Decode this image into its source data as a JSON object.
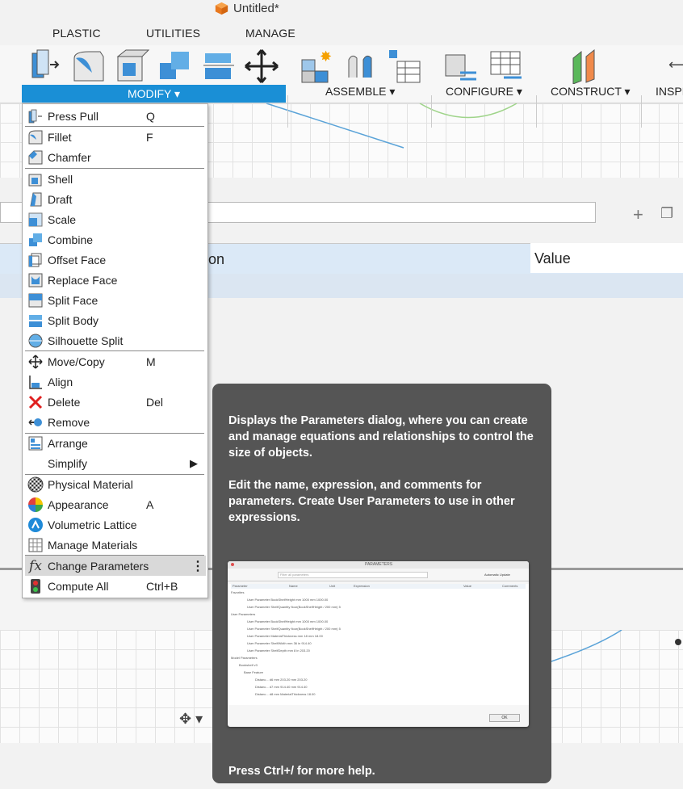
{
  "window": {
    "title": "Untitled*"
  },
  "ribbon": {
    "tabs": [
      "PLASTIC",
      "UTILITIES",
      "MANAGE"
    ],
    "groups": {
      "modify": "MODIFY ▾",
      "assemble": "ASSEMBLE ▾",
      "configure": "CONFIGURE ▾",
      "construct": "CONSTRUCT ▾",
      "inspect": "INSPI"
    }
  },
  "parameters_panel": {
    "header_partial": "on",
    "header_value": "Value",
    "add_icon": "+"
  },
  "menu": {
    "items": [
      {
        "label": "Press Pull",
        "shortcut": "Q",
        "icon": "press-pull-icon"
      },
      {
        "label": "Fillet",
        "shortcut": "F",
        "icon": "fillet-icon"
      },
      {
        "label": "Chamfer",
        "shortcut": "",
        "icon": "chamfer-icon"
      },
      {
        "label": "Shell",
        "shortcut": "",
        "icon": "shell-icon"
      },
      {
        "label": "Draft",
        "shortcut": "",
        "icon": "draft-icon"
      },
      {
        "label": "Scale",
        "shortcut": "",
        "icon": "scale-icon"
      },
      {
        "label": "Combine",
        "shortcut": "",
        "icon": "combine-icon"
      },
      {
        "label": "Offset Face",
        "shortcut": "",
        "icon": "offset-face-icon"
      },
      {
        "label": "Replace Face",
        "shortcut": "",
        "icon": "replace-face-icon"
      },
      {
        "label": "Split Face",
        "shortcut": "",
        "icon": "split-face-icon"
      },
      {
        "label": "Split Body",
        "shortcut": "",
        "icon": "split-body-icon"
      },
      {
        "label": "Silhouette Split",
        "shortcut": "",
        "icon": "silhouette-split-icon"
      },
      {
        "label": "Move/Copy",
        "shortcut": "M",
        "icon": "move-copy-icon"
      },
      {
        "label": "Align",
        "shortcut": "",
        "icon": "align-icon"
      },
      {
        "label": "Delete",
        "shortcut": "Del",
        "icon": "delete-icon"
      },
      {
        "label": "Remove",
        "shortcut": "",
        "icon": "remove-icon"
      },
      {
        "label": "Arrange",
        "shortcut": "",
        "icon": "arrange-icon"
      },
      {
        "label": "Simplify",
        "shortcut": "",
        "icon": "submenu-arrow-icon"
      },
      {
        "label": "Physical Material",
        "shortcut": "",
        "icon": "physical-material-icon"
      },
      {
        "label": "Appearance",
        "shortcut": "A",
        "icon": "appearance-icon"
      },
      {
        "label": "Volumetric Lattice",
        "shortcut": "",
        "icon": "volumetric-lattice-icon"
      },
      {
        "label": "Manage Materials",
        "shortcut": "",
        "icon": "manage-materials-icon"
      },
      {
        "label": "Change Parameters",
        "shortcut": "⋮",
        "icon": "fx-icon"
      },
      {
        "label": "Compute All",
        "shortcut": "Ctrl+B",
        "icon": "compute-all-icon"
      }
    ]
  },
  "tooltip": {
    "para1": "Displays the Parameters dialog, where you can create and manage equations and relationships to control the size of objects.",
    "para2": "Edit the name, expression, and comments for parameters. Create User Parameters to use in other expressions.",
    "footer": "Press Ctrl+/ for more help.",
    "preview": {
      "title": "PARAMETERS",
      "filter_placeholder": "Filter all parameters",
      "auto_update": "Automatic Update",
      "columns": [
        "Parameter",
        "Name",
        "Unit",
        "Expression",
        "Value",
        "Comments"
      ],
      "rows": [
        "Favorites",
        "User Parameter   BookShelfHeight   mm   1000 mm   1000.00",
        "User Parameter   ShelfQuantity   floor(BookShelfHeight / 200 mm)   5",
        "User Parameters",
        "User Parameter   BookShelfHeight   mm   1000 mm   1000.00",
        "User Parameter   ShelfQuantity   floor(BookShelfHeight / 200 mm)   5",
        "User Parameter   MaterialThickness   mm   18 mm   18.00",
        "User Parameter   ShelfWidth   mm   36 in   914.40",
        "User Parameter   ShelfDepth   mm   8 in   203.20",
        "Model Parameters",
        "Bookshelf v3",
        "Base Feature",
        "Distanc...   d6   mm   203.20 mm   203.20",
        "Distanc...   d7   mm   914.40 mm   914.40",
        "Distanc...   d8   mm   MaterialThickness   18.00"
      ],
      "ok": "OK"
    }
  }
}
